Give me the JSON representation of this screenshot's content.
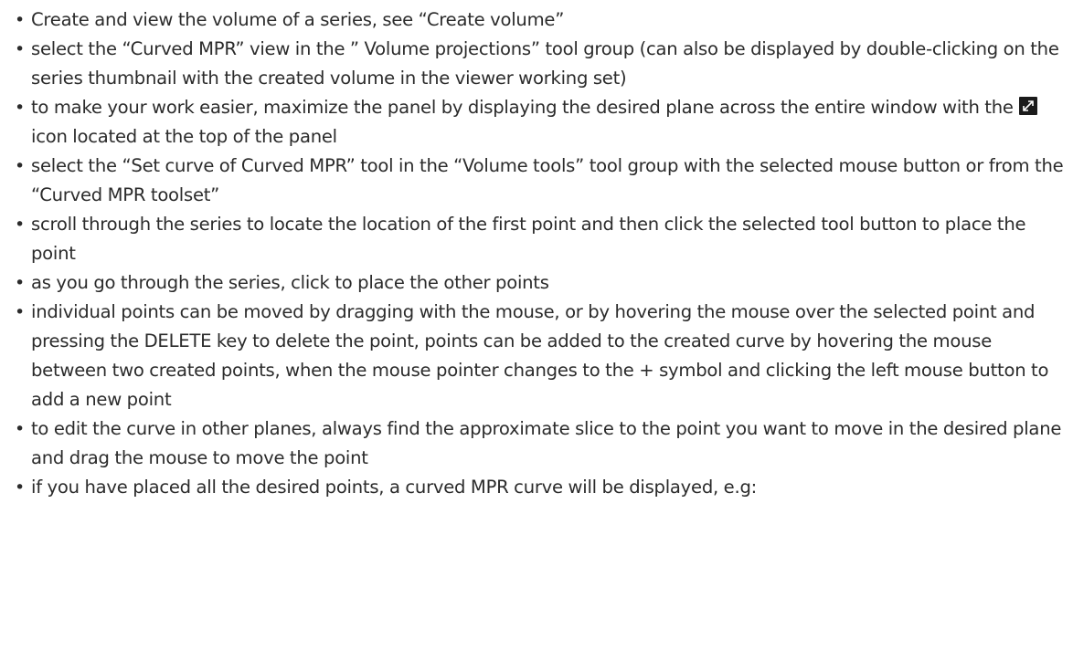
{
  "steps": [
    {
      "text": "Create and view the volume of a series, see “Create volume”"
    },
    {
      "text": "select the “Curved MPR” view in the ” Volume projections” tool group (can also be displayed by double-clicking on the series thumbnail with the created volume in the viewer working set)"
    },
    {
      "text_before": "to make your work easier, maximize the panel by displaying the desired plane across the entire window with the ",
      "icon": "maximize-icon",
      "text_after": " icon located at the top of the panel"
    },
    {
      "text": "select the “Set curve of Curved MPR” tool in the “Volume tools” tool group with the selected mouse button or from the “Curved MPR toolset”"
    },
    {
      "text": "scroll through the series to locate the location of the first point and then click the selected tool button to place the point"
    },
    {
      "text": "as you go through the series, click to place the other points"
    },
    {
      "text": "individual points can be moved by dragging with the mouse, or by hovering the mouse over the selected point and pressing the DELETE key to delete the point, points can be added to the created curve by hovering the mouse between two created points, when the mouse pointer changes to the + symbol and clicking the left mouse button to add a new point"
    },
    {
      "text": "to edit the curve in other planes, always find the approximate slice to the point you want to move in the desired plane and drag the mouse to move the point"
    },
    {
      "text": "if you have placed all the desired points, a curved MPR curve will be displayed, e.g:"
    }
  ],
  "bullet_char": "•",
  "colors": {
    "text": "#2b2b2b",
    "icon_bg": "#1b1b1b",
    "icon_arrow": "#ffffff"
  }
}
